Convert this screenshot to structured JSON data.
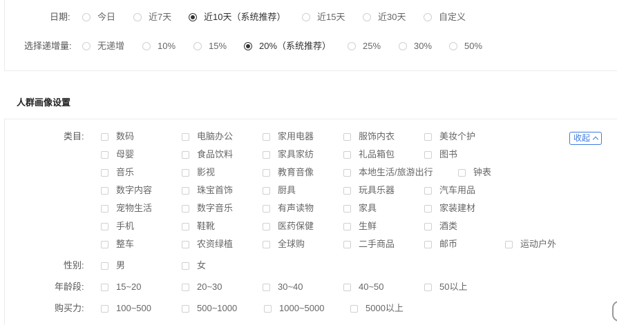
{
  "date": {
    "label": "日期:",
    "options": [
      "今日",
      "近7天",
      "近10天（系统推荐）",
      "近15天",
      "近30天",
      "自定义"
    ],
    "selected_index": 2
  },
  "increment": {
    "label": "选择递增量:",
    "options": [
      "无递增",
      "10%",
      "15%",
      "20%（系统推荐）",
      "25%",
      "30%",
      "50%"
    ],
    "selected_index": 3
  },
  "persona": {
    "title": "人群画像设置",
    "collapse_label": "收起",
    "category_label": "类目:",
    "categories": [
      [
        "数码",
        "电脑办公",
        "家用电器",
        "服饰内衣",
        "美妆个护"
      ],
      [
        "母婴",
        "食品饮料",
        "家具家纺",
        "礼品箱包",
        "图书"
      ],
      [
        "音乐",
        "影视",
        "教育音像",
        "本地生活/旅游出行",
        "钟表"
      ],
      [
        "数字内容",
        "珠宝首饰",
        "厨具",
        "玩具乐器",
        "汽车用品"
      ],
      [
        "宠物生活",
        "数字音乐",
        "有声读物",
        "家具",
        "家装建材"
      ],
      [
        "手机",
        "鞋靴",
        "医药保健",
        "生鲜",
        "酒类"
      ],
      [
        "整车",
        "农资绿植",
        "全球购",
        "二手商品",
        "邮币",
        "运动户外"
      ]
    ],
    "gender_label": "性别:",
    "genders": [
      "男",
      "女"
    ],
    "age_label": "年龄段:",
    "ages": [
      "15~20",
      "20~30",
      "30~40",
      "40~50",
      "50以上"
    ],
    "spending_label": "购买力:",
    "spending": [
      "100~500",
      "500~1000",
      "1000~5000",
      "5000以上"
    ]
  },
  "icons": {
    "collapse": "chevron-up-icon",
    "edge": "scroll-handle-icon"
  }
}
